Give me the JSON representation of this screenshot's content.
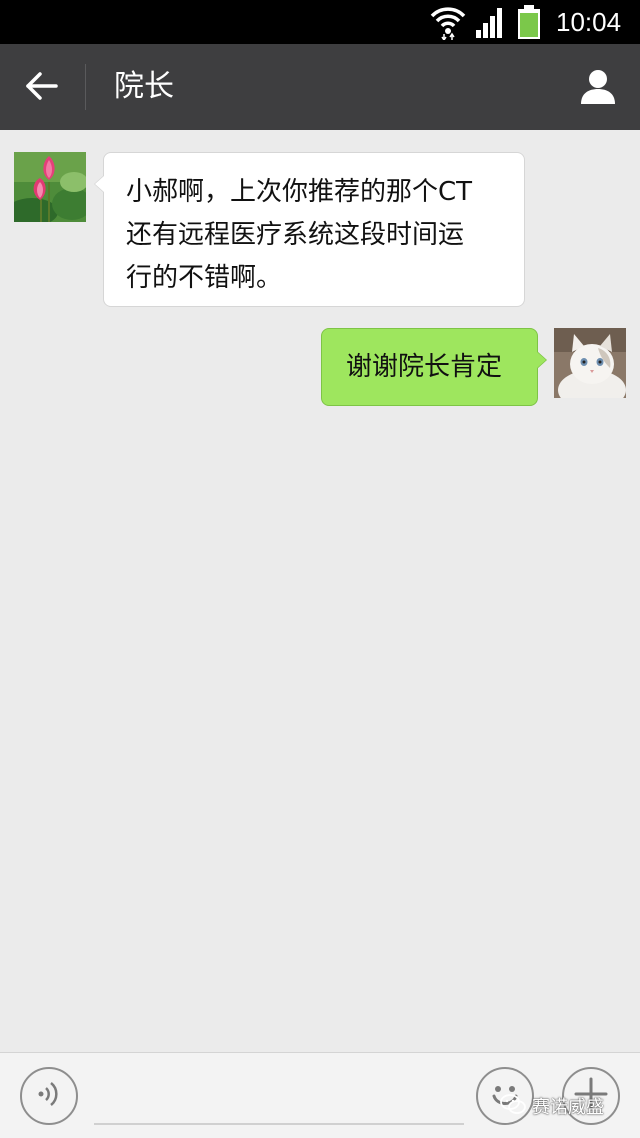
{
  "status_bar": {
    "time": "10:04",
    "icons": [
      "wifi-icon",
      "signal-icon",
      "battery-icon"
    ],
    "battery_color": "#7bc84a"
  },
  "header": {
    "title": "院长",
    "back_icon": "arrow-left-icon",
    "profile_icon": "person-icon",
    "background": "#3e3e40"
  },
  "messages": [
    {
      "side": "left",
      "avatar": "lotus-flower-avatar",
      "text": "小郝啊，上次你推荐的那个CT还有远程医疗系统这段时间运行的不错啊。",
      "lines": [
        "小郝啊，上次你推荐的那个CT",
        "还有远程医疗系统这段时间运",
        "行的不错啊。"
      ],
      "bubble_color": "#ffffff"
    },
    {
      "side": "right",
      "avatar": "white-cat-avatar",
      "text": "谢谢院长肯定",
      "bubble_color": "#9ee65e"
    }
  ],
  "input_bar": {
    "voice_icon": "voice-wave-icon",
    "emoji_icon": "smiley-icon",
    "plus_icon": "plus-icon",
    "input_value": ""
  },
  "watermark": {
    "text": "赛诺威盛",
    "icon": "wechat-icon"
  }
}
